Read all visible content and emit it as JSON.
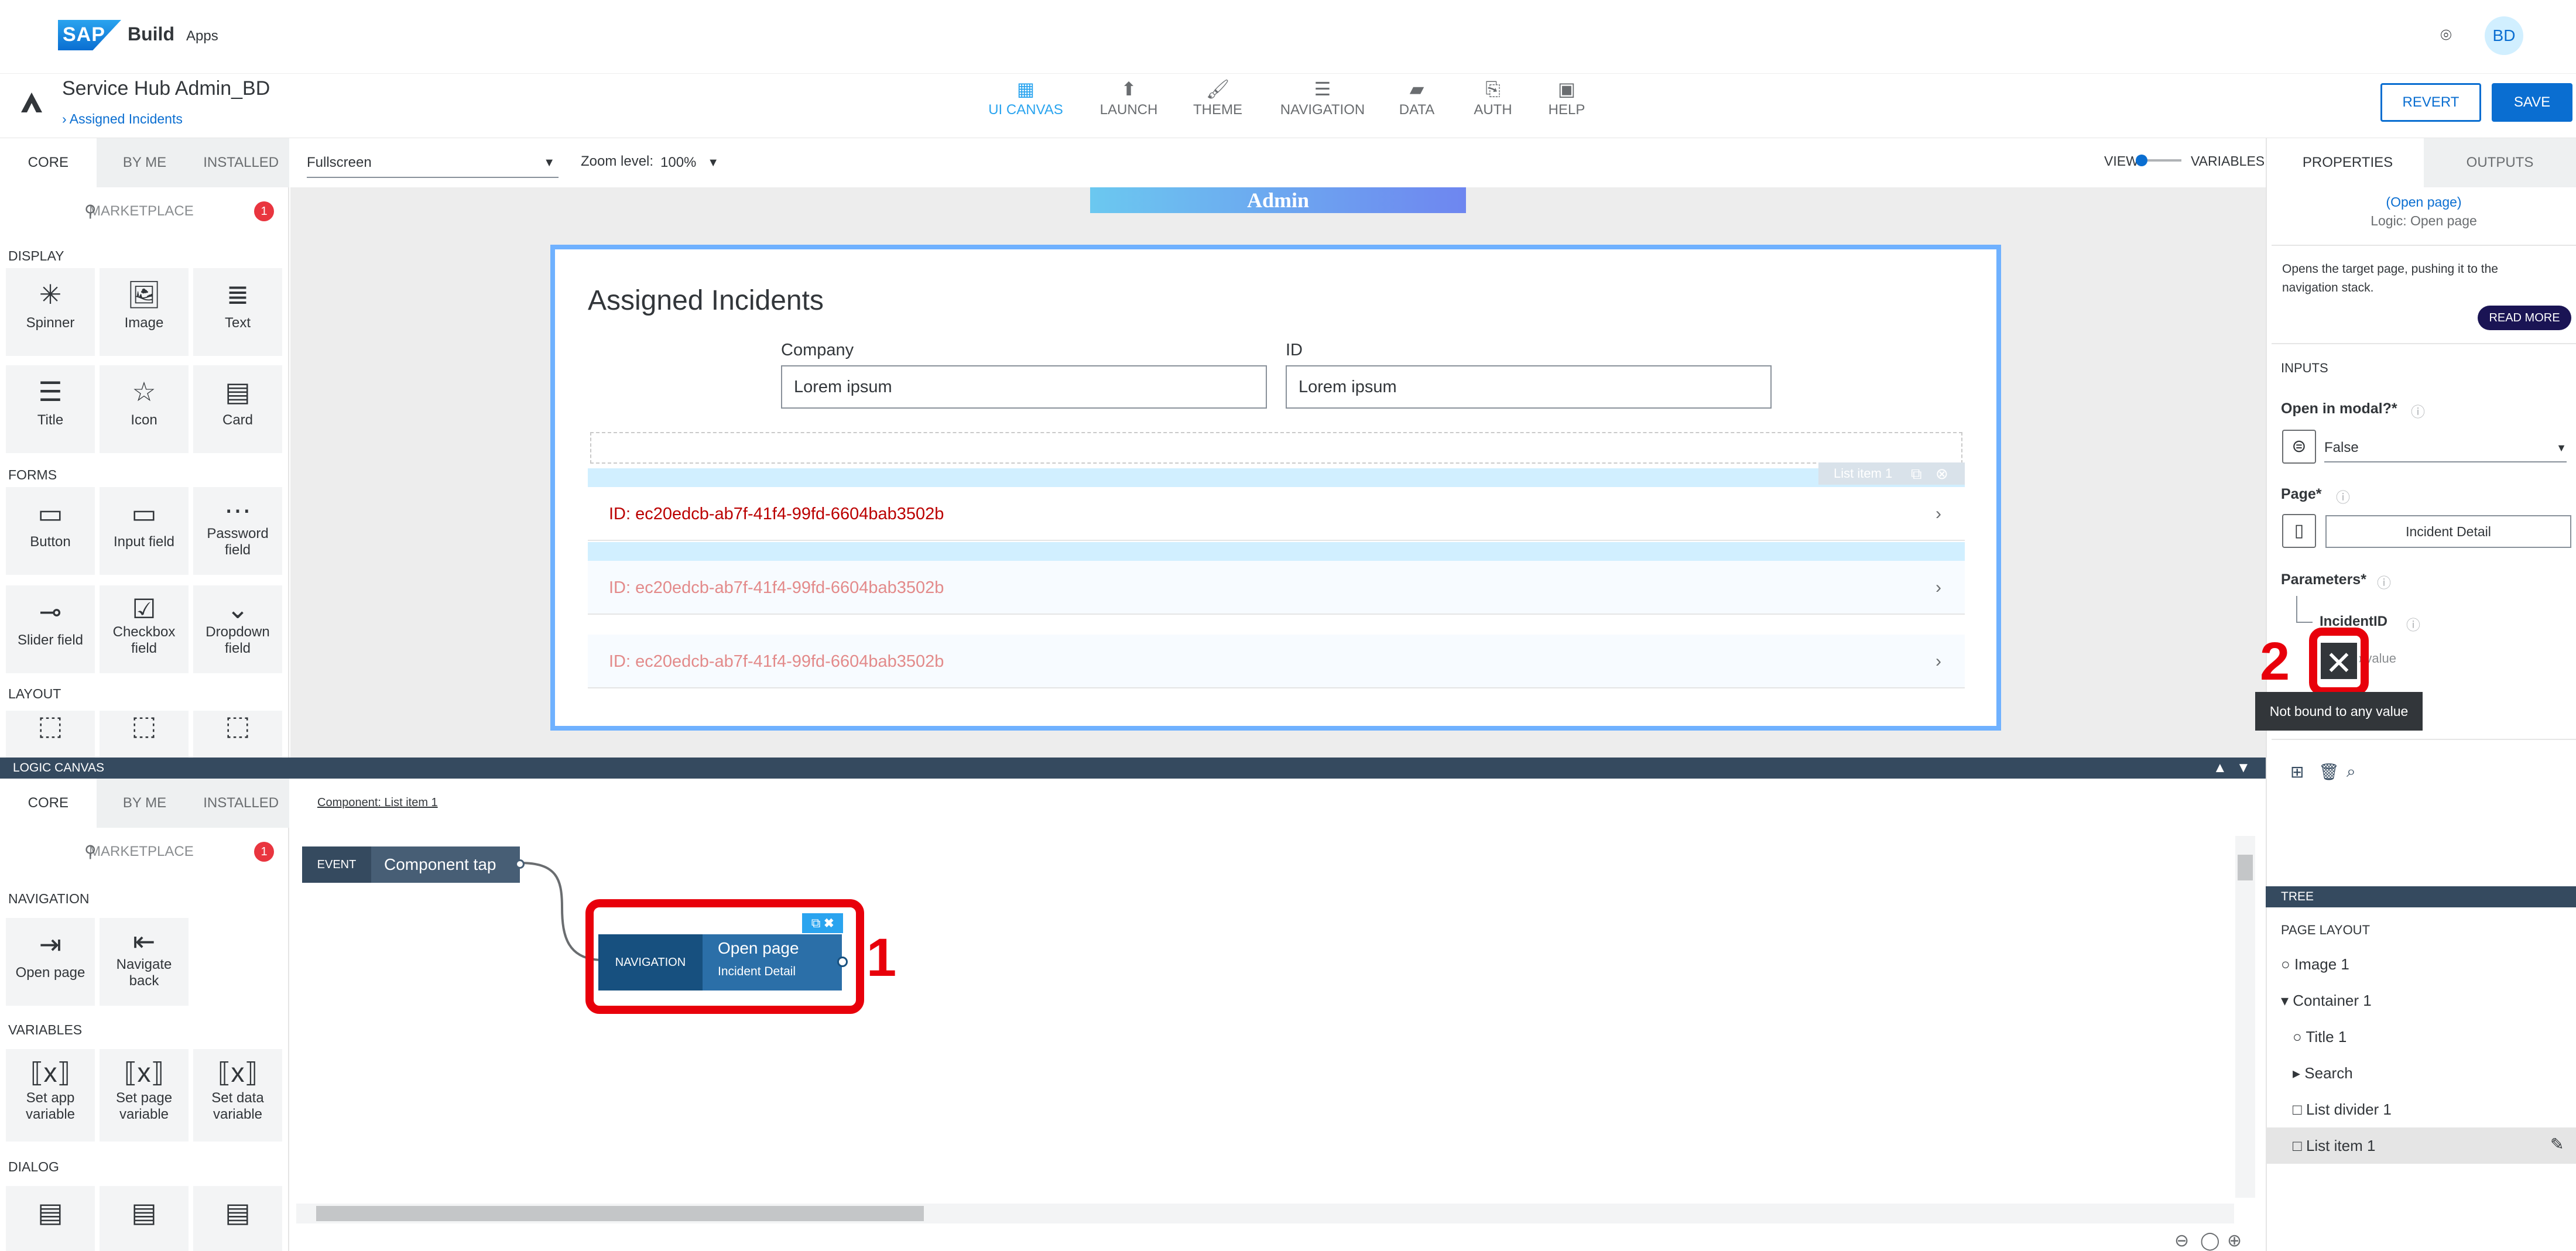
{
  "shell": {
    "logo": "SAP",
    "product": "Build",
    "sub": "Apps",
    "avatar": "BD"
  },
  "app": {
    "name": "Service Hub Admin_BD",
    "breadcrumb": "Assigned Incidents"
  },
  "topnav": [
    {
      "label": "UI CANVAS",
      "icon": "▦"
    },
    {
      "label": "LAUNCH",
      "icon": "⬆"
    },
    {
      "label": "THEME",
      "icon": "🖌"
    },
    {
      "label": "NAVIGATION",
      "icon": "☰"
    },
    {
      "label": "DATA",
      "icon": "▰"
    },
    {
      "label": "AUTH",
      "icon": "⎘"
    },
    {
      "label": "HELP",
      "icon": "▣"
    }
  ],
  "actions": {
    "revert": "REVERT",
    "save": "SAVE"
  },
  "palette_tabs": [
    "CORE",
    "BY ME",
    "INSTALLED"
  ],
  "marketplace": {
    "label": "MARKETPLACE",
    "count": "1"
  },
  "palette_top": {
    "display": "DISPLAY",
    "display_items": [
      "Spinner",
      "Image",
      "Text",
      "Title",
      "Icon",
      "Card"
    ],
    "forms": "FORMS",
    "forms_items": [
      "Button",
      "Input field",
      "Password field",
      "Slider field",
      "Checkbox field",
      "Dropdown field"
    ],
    "layout": "LAYOUT"
  },
  "canvas_bar": {
    "view_mode": "Fullscreen",
    "zoom_label": "Zoom level:",
    "zoom_value": "100%",
    "view": "VIEW",
    "variables": "VARIABLES"
  },
  "page": {
    "header_image": "Admin",
    "title": "Assigned Incidents",
    "company_label": "Company",
    "company_value": "Lorem ipsum",
    "id_label": "ID",
    "id_value": "Lorem ipsum",
    "list_item_tag": "List item 1",
    "rows": [
      "ID: ec20edcb-ab7f-41f4-99fd-6604bab3502b",
      "ID: ec20edcb-ab7f-41f4-99fd-6604bab3502b",
      "ID: ec20edcb-ab7f-41f4-99fd-6604bab3502b"
    ]
  },
  "logic": {
    "title": "LOGIC CANVAS",
    "component": "Component: List item 1",
    "event_tag": "EVENT",
    "event_label": "Component tap",
    "node_tag": "NAVIGATION",
    "node_title": "Open page",
    "node_sub": "Incident Detail",
    "annotation": "1"
  },
  "palette_bottom": {
    "navigation": "NAVIGATION",
    "nav_items": [
      "Open page",
      "Navigate back"
    ],
    "variables": "VARIABLES",
    "var_items": [
      "Set app variable",
      "Set page variable",
      "Set data variable"
    ],
    "dialog": "DIALOG"
  },
  "properties": {
    "tabs": [
      "PROPERTIES",
      "OUTPUTS"
    ],
    "link": "(Open page)",
    "logic_name": "Logic: Open page",
    "description": "Opens the target page, pushing it to the navigation stack.",
    "read_more": "READ MORE",
    "inputs": "INPUTS",
    "modal_label": "Open in modal?*",
    "modal_value": "False",
    "page_label": "Page*",
    "page_value": "Incident Detail",
    "params_label": "Parameters*",
    "param_name": "IncidentID",
    "param_value": "o value",
    "annotation": "2",
    "tooltip": "Not bound to any value"
  },
  "tree": {
    "header": "TREE",
    "page_layout": "PAGE LAYOUT",
    "items": [
      "Image 1",
      "Container 1",
      "Title 1",
      "Search",
      "List divider 1",
      "List item 1"
    ]
  },
  "colors": {
    "accent": "#0a6ed1",
    "annotation": "#e8000b",
    "frame": "#6fb1ff",
    "logic_bar": "#354a5f"
  }
}
